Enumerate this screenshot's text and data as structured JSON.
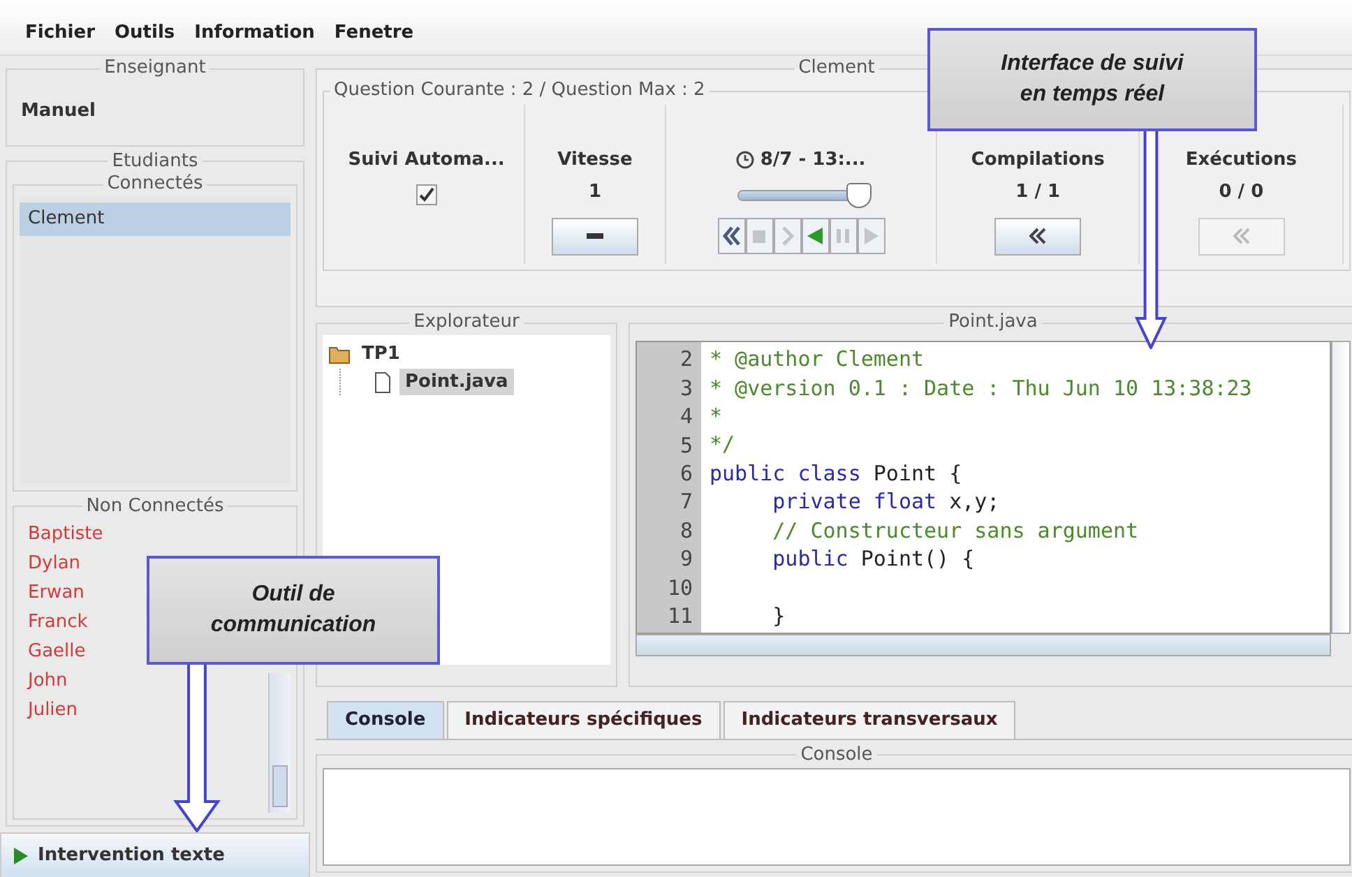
{
  "menu": [
    {
      "label": "Fichier"
    },
    {
      "label": "Outils"
    },
    {
      "label": "Information"
    },
    {
      "label": "Fenetre"
    }
  ],
  "teacher_panel": {
    "title": "Enseignant",
    "name": "Manuel"
  },
  "students_panel": {
    "title": "Etudiants",
    "connected": {
      "title": "Connectés",
      "students": [
        {
          "name": "Clement",
          "selected": true
        }
      ]
    },
    "not_connected": {
      "title": "Non Connectés",
      "students": [
        {
          "name": "Baptiste",
          "selected": false
        },
        {
          "name": "Dylan",
          "selected": false
        },
        {
          "name": "Erwan",
          "selected": false
        },
        {
          "name": "Franck",
          "selected": false
        },
        {
          "name": "Gaelle",
          "selected": false
        },
        {
          "name": "John",
          "selected": false
        },
        {
          "name": "Julien",
          "selected": false
        }
      ]
    }
  },
  "intervention_button": {
    "label": "Intervention texte"
  },
  "student_view": {
    "title": "Clement",
    "question_info": "Question Courante : 2 / Question Max : 2",
    "toolbar": [
      {
        "kind": "checkbox",
        "title": "Suivi Automa...",
        "checked": true
      },
      {
        "kind": "speed",
        "title": "Vitesse",
        "value": "1"
      },
      {
        "kind": "timeline",
        "title": "8/7 - 13:...",
        "level": 0.95,
        "controls": [
          {
            "kind": "rewind",
            "disabled": false
          },
          {
            "kind": "stop",
            "disabled": true
          },
          {
            "kind": "forward",
            "disabled": true
          },
          {
            "kind": "play-back",
            "disabled": false
          },
          {
            "kind": "pause",
            "disabled": true
          },
          {
            "kind": "play",
            "disabled": true
          }
        ]
      },
      {
        "kind": "counter",
        "title": "Compilations",
        "value": "1 / 1",
        "disabled": false
      },
      {
        "kind": "counter",
        "title": "Exécutions",
        "value": "0 / 0",
        "disabled": true
      }
    ]
  },
  "explorer": {
    "title": "Explorateur",
    "tree": [
      {
        "label": "TP1",
        "kind": "folder",
        "selected": false,
        "children": [
          {
            "label": "Point.java",
            "kind": "file",
            "selected": true
          }
        ]
      }
    ]
  },
  "editor": {
    "title": "Point.java",
    "lines": [
      {
        "number": "2",
        "segments": [
          {
            "text": "* @author Clement",
            "kind": "comment"
          }
        ]
      },
      {
        "number": "3",
        "segments": [
          {
            "text": "* @version 0.1 : Date : Thu Jun 10 13:38:23",
            "kind": "comment"
          }
        ]
      },
      {
        "number": "4",
        "segments": [
          {
            "text": "*",
            "kind": "comment"
          }
        ]
      },
      {
        "number": "5",
        "segments": [
          {
            "text": "*/",
            "kind": "comment"
          }
        ]
      },
      {
        "number": "6",
        "segments": [
          {
            "text": "public class",
            "kind": "keyword"
          },
          {
            "text": " Point {",
            "kind": "plain"
          }
        ]
      },
      {
        "number": "7",
        "segments": [
          {
            "text": "     private float",
            "kind": "keyword"
          },
          {
            "text": " x,y;",
            "kind": "plain"
          }
        ]
      },
      {
        "number": "8",
        "segments": [
          {
            "text": "     // Constructeur sans argument",
            "kind": "comment"
          }
        ]
      },
      {
        "number": "9",
        "segments": [
          {
            "text": "     public",
            "kind": "keyword"
          },
          {
            "text": " Point() {",
            "kind": "plain"
          }
        ]
      },
      {
        "number": "10"
      },
      {
        "number": "11",
        "segments": [
          {
            "text": "     }",
            "kind": "plain"
          }
        ]
      }
    ]
  },
  "bottom_tabs": [
    {
      "label": "Console",
      "selected": true
    },
    {
      "label": "Indicateurs spécifiques",
      "selected": false
    },
    {
      "label": "Indicateurs transversaux",
      "selected": false
    }
  ],
  "console": {
    "title": "Console"
  },
  "annotations": [
    {
      "text": "Interface de suivi\nen temps réel"
    },
    {
      "text": "Outil de\ncommunication"
    }
  ]
}
